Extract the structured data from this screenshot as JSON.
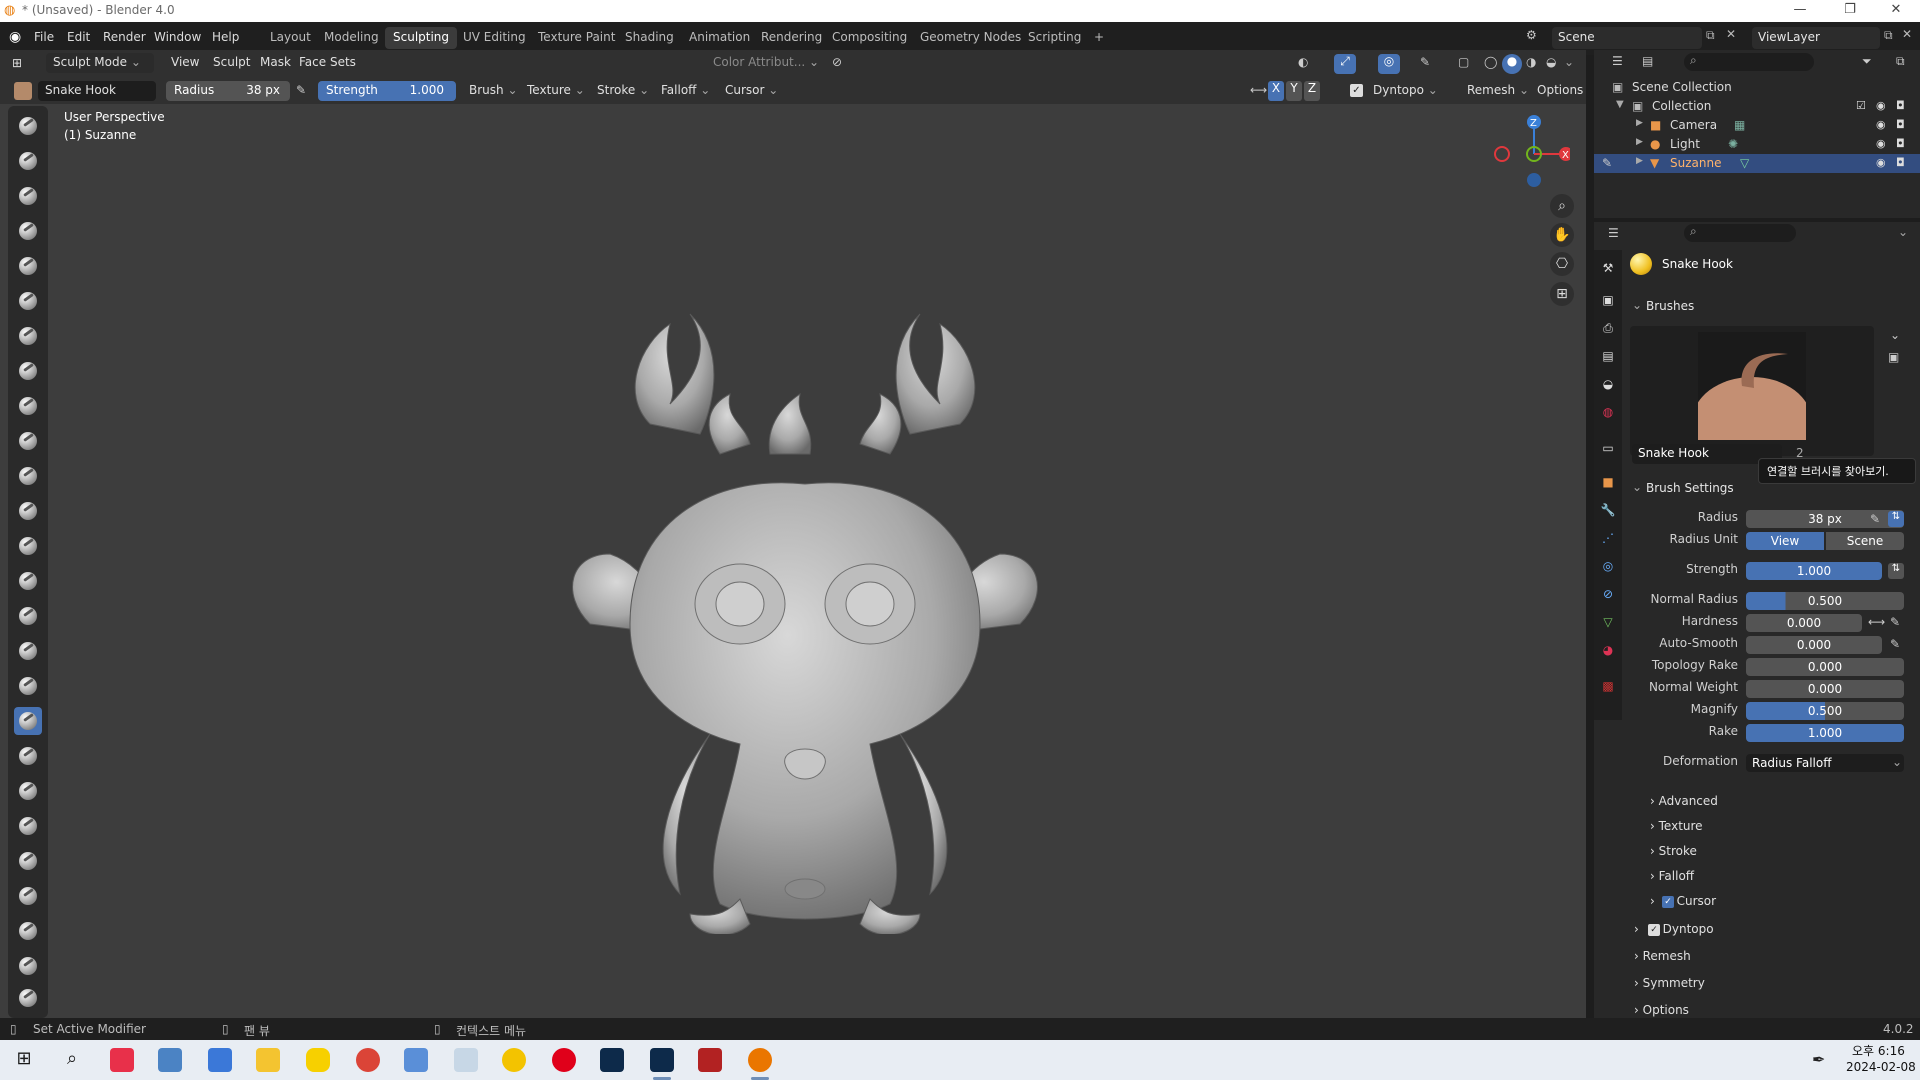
{
  "window": {
    "title": "* (Unsaved) - Blender 4.0",
    "controls": [
      "—",
      "❐",
      "✕"
    ]
  },
  "menu": [
    "File",
    "Edit",
    "Render",
    "Window",
    "Help"
  ],
  "workspaces": [
    "Layout",
    "Modeling",
    "Sculpting",
    "UV Editing",
    "Texture Paint",
    "Shading",
    "Animation",
    "Rendering",
    "Compositing",
    "Geometry Nodes",
    "Scripting",
    "+"
  ],
  "active_workspace": "Sculpting",
  "scene": {
    "label": "Scene",
    "viewlayer": "ViewLayer"
  },
  "viewport_header": {
    "mode": "Sculpt Mode",
    "menus": [
      "View",
      "Sculpt",
      "Mask",
      "Face Sets"
    ],
    "color_attribute": "Color Attribut...",
    "search_placeholder": ""
  },
  "tool_header": {
    "brush_name": "Snake Hook",
    "radius_label": "Radius",
    "radius_value": "38 px",
    "strength_label": "Strength",
    "strength_value": "1.000",
    "dropdowns": [
      "Brush",
      "Texture",
      "Stroke",
      "Falloff",
      "Cursor"
    ],
    "axes": [
      "X",
      "Y",
      "Z"
    ],
    "dyntopo": "Dyntopo",
    "remesh": "Remesh",
    "options": "Options"
  },
  "overlay_text": {
    "perspective": "User Perspective",
    "object": "(1) Suzanne"
  },
  "gizmo": {
    "z": "Z",
    "x": "X"
  },
  "outliner": {
    "root": "Scene Collection",
    "collection": "Collection",
    "items": [
      {
        "name": "Camera",
        "selected": false
      },
      {
        "name": "Light",
        "selected": false
      },
      {
        "name": "Suzanne",
        "selected": true
      }
    ]
  },
  "properties": {
    "active_brush": "Snake Hook",
    "brushes_panel": "Brushes",
    "brush_field": "Snake Hook",
    "brush_users": "2",
    "tooltip": "연결할 브러시를 찾아보기.",
    "brush_settings": "Brush Settings",
    "settings": [
      {
        "label": "Radius",
        "value": "38 px",
        "fill": 0.0,
        "kind": "blue"
      },
      {
        "label": "Strength",
        "value": "1.000",
        "fill": 1.0,
        "kind": "blue"
      },
      {
        "label": "Normal Radius",
        "value": "0.500",
        "fill": 0.25,
        "kind": "bar"
      },
      {
        "label": "Hardness",
        "value": "0.000",
        "fill": 0.0,
        "kind": "bar"
      },
      {
        "label": "Auto-Smooth",
        "value": "0.000",
        "fill": 0.0,
        "kind": "bar"
      },
      {
        "label": "Topology Rake",
        "value": "0.000",
        "fill": 0.0,
        "kind": "bar"
      },
      {
        "label": "Normal Weight",
        "value": "0.000",
        "fill": 0.0,
        "kind": "bar"
      },
      {
        "label": "Magnify",
        "value": "0.500",
        "fill": 0.5,
        "kind": "bar"
      },
      {
        "label": "Rake",
        "value": "1.000",
        "fill": 1.0,
        "kind": "bar"
      }
    ],
    "radius_unit_label": "Radius Unit",
    "radius_unit": [
      "View",
      "Scene"
    ],
    "deformation_label": "Deformation",
    "deformation": "Radius Falloff",
    "subpanels": [
      "Advanced",
      "Texture",
      "Stroke",
      "Falloff",
      "Cursor"
    ],
    "panels": [
      "Dyntopo",
      "Remesh",
      "Symmetry",
      "Options"
    ]
  },
  "status": {
    "left": "Set Active Modifier",
    "mid1": "팬 뷰",
    "mid2": "컨텍스트 메뉴",
    "version": "4.0.2"
  },
  "taskbar": {
    "time": "오후 6:16",
    "date": "2024-02-08"
  },
  "colors": {
    "accent": "#4772b3",
    "selection": "#334d80",
    "x_axis": "#e0383d",
    "y_axis": "#72b51d",
    "z_axis": "#3a80d8"
  }
}
